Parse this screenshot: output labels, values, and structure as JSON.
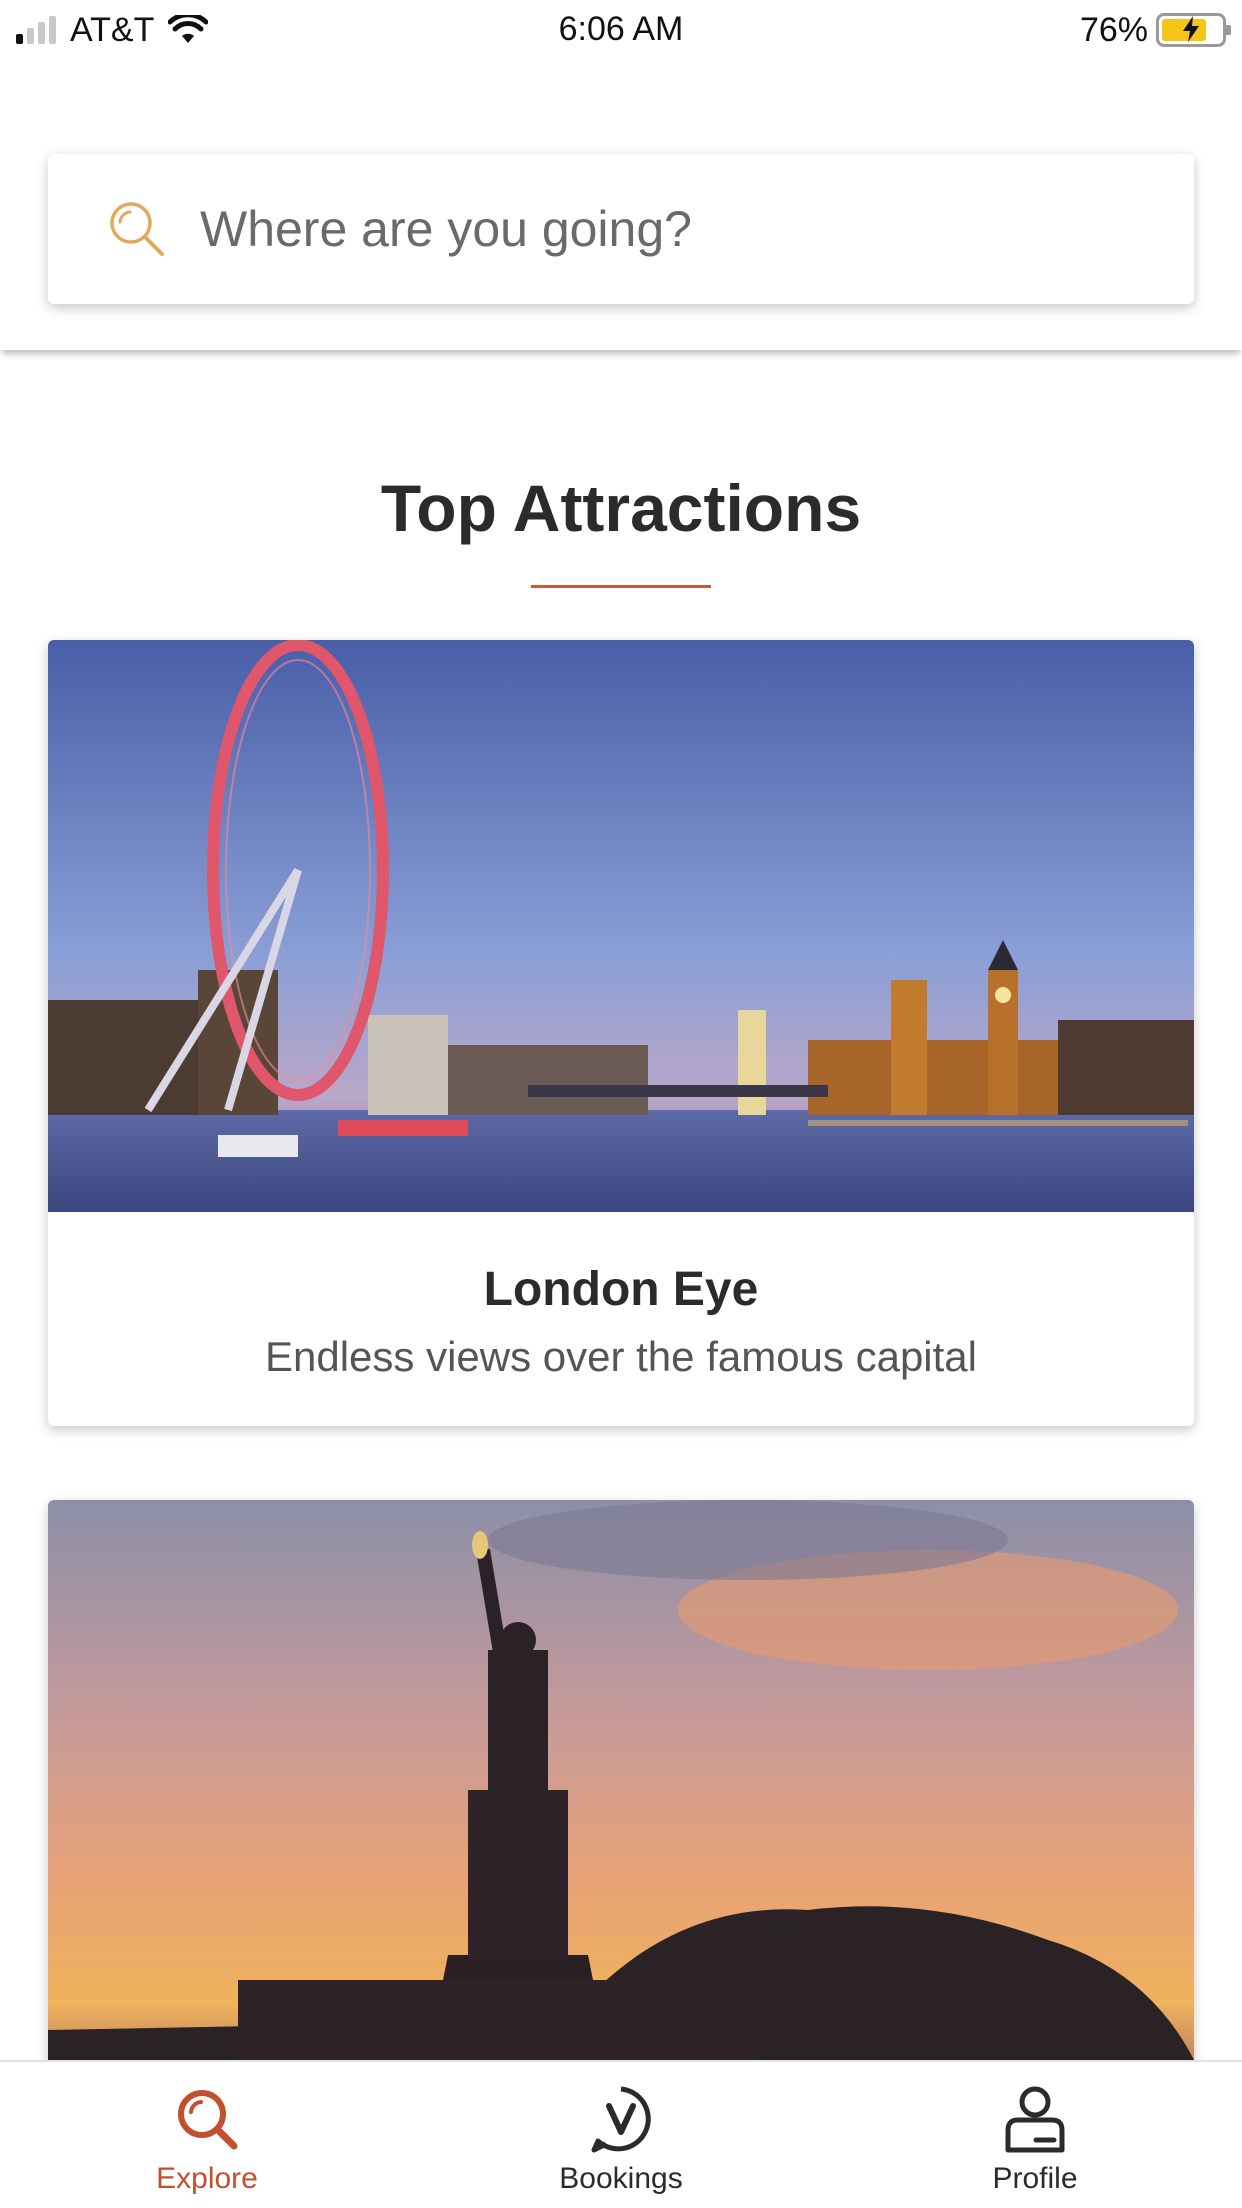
{
  "status_bar": {
    "carrier": "AT&T",
    "time": "6:06 AM",
    "battery_percent": "76%",
    "signal_bars_filled": 1,
    "signal_bars_total": 4,
    "battery_level": 0.76
  },
  "search": {
    "placeholder": "Where are you going?",
    "icon": "search-icon",
    "icon_color": "#e2a95c"
  },
  "section": {
    "title": "Top Attractions",
    "accent_color": "#c75b3a"
  },
  "attractions": [
    {
      "title": "London Eye",
      "subtitle": "Endless views over the famous capital",
      "image": "london-eye-thames-dusk"
    },
    {
      "title": "",
      "subtitle": "",
      "image": "statue-of-liberty-sunset"
    }
  ],
  "bottom_nav": {
    "active_color": "#c24f2e",
    "items": [
      {
        "label": "Explore",
        "icon": "search-icon",
        "active": true
      },
      {
        "label": "Bookings",
        "icon": "bookings-v-icon",
        "active": false
      },
      {
        "label": "Profile",
        "icon": "profile-icon",
        "active": false
      }
    ]
  }
}
